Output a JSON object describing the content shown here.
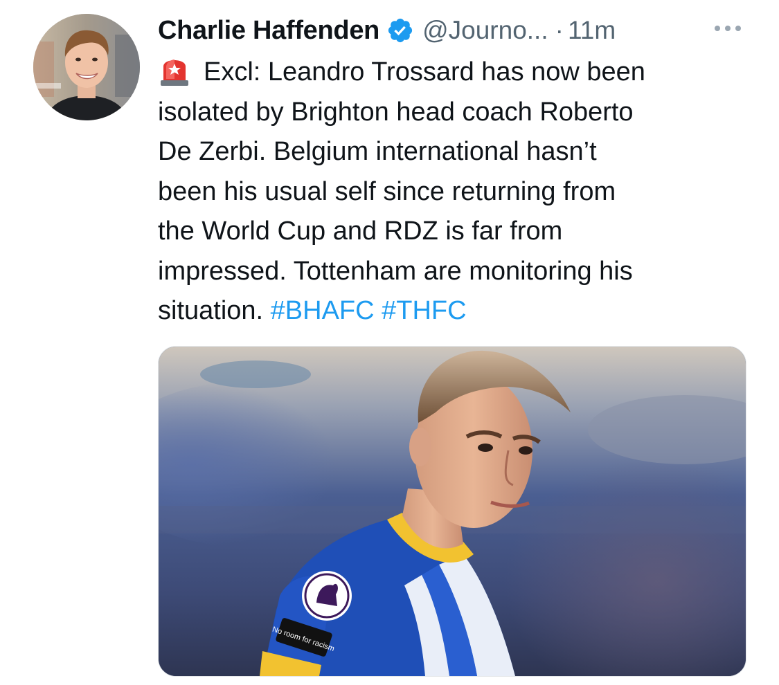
{
  "tweet": {
    "author": {
      "display_name": "Charlie Haffenden",
      "handle": "@Journo...",
      "verified": true
    },
    "separator": "·",
    "time": "11m",
    "text_lines": [
      {
        "prefix_icon": "rotating-light-icon",
        "text": "Excl: Leandro Trossard has now been"
      },
      {
        "text": "isolated by Brighton head coach Roberto"
      },
      {
        "text": "De Zerbi. Belgium international hasn’t"
      },
      {
        "text": "been his usual self since returning from"
      },
      {
        "text": "the World Cup and RDZ is far from"
      },
      {
        "text": "impressed. Tottenham are monitoring his"
      },
      {
        "text": "situation.",
        "hashtags": [
          "#BHAFC",
          "#THFC"
        ]
      }
    ],
    "media": {
      "alt": "Leandro Trossard in a blue and white striped Brighton shirt with Premier League and No Room For Racism sleeve badges",
      "badge_text": "No room for racism"
    }
  },
  "colors": {
    "text": "#0f1419",
    "secondary": "#536471",
    "link": "#1d9bf0",
    "verified": "#1d9bf0"
  }
}
